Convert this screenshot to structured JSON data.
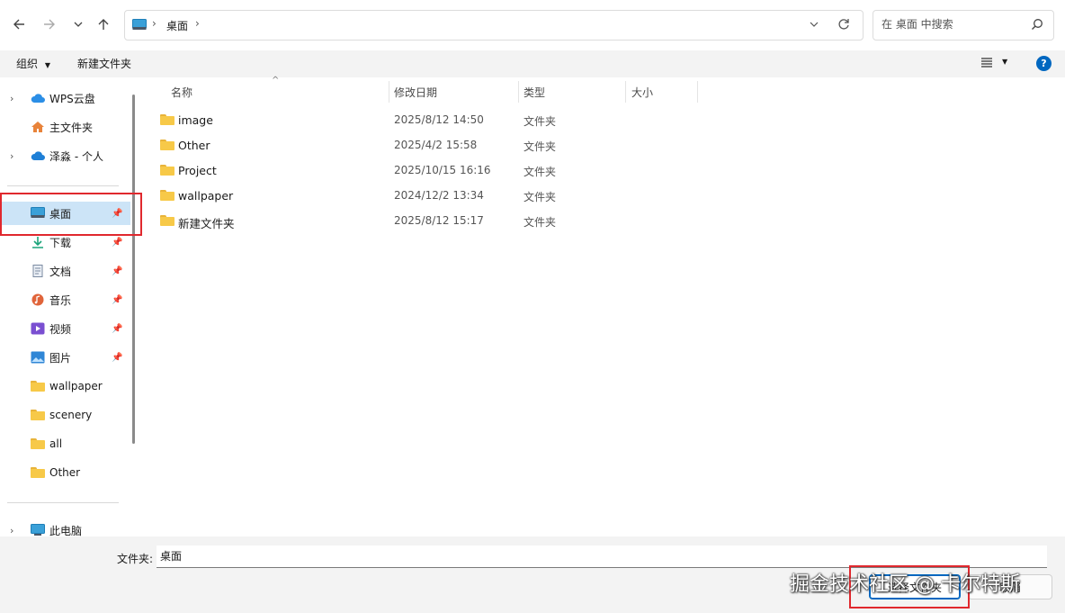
{
  "address": {
    "location": "桌面"
  },
  "search": {
    "placeholder": "在 桌面 中搜索"
  },
  "toolbar": {
    "organize_label": "组织",
    "new_folder_label": "新建文件夹"
  },
  "sidebar": {
    "top_items": [
      {
        "label": "WPS云盘"
      },
      {
        "label": "主文件夹"
      },
      {
        "label": "泽淼 - 个人"
      }
    ],
    "pinned_items": [
      {
        "label": "桌面"
      },
      {
        "label": "下载"
      },
      {
        "label": "文档"
      },
      {
        "label": "音乐"
      },
      {
        "label": "视频"
      },
      {
        "label": "图片"
      }
    ],
    "folder_items": [
      {
        "label": "wallpaper"
      },
      {
        "label": "scenery"
      },
      {
        "label": "all"
      },
      {
        "label": "Other"
      }
    ],
    "this_pc_label": "此电脑"
  },
  "columns": {
    "name": "名称",
    "date": "修改日期",
    "type": "类型",
    "size": "大小"
  },
  "files": [
    {
      "name": "image",
      "date": "2025/8/12 14:50",
      "type": "文件夹"
    },
    {
      "name": "Other",
      "date": "2025/4/2 15:58",
      "type": "文件夹"
    },
    {
      "name": "Project",
      "date": "2025/10/15 16:16",
      "type": "文件夹"
    },
    {
      "name": "wallpaper",
      "date": "2024/12/2 13:34",
      "type": "文件夹"
    },
    {
      "name": "新建文件夹",
      "date": "2025/8/12 15:17",
      "type": "文件夹"
    }
  ],
  "footer": {
    "folder_label": "文件夹:",
    "folder_value": "桌面",
    "select_button": "选择文件夹",
    "cancel_button": "取消"
  },
  "watermark": "掘金技术社区 @ 卡尔特斯",
  "colors": {
    "accent": "#0067c0",
    "highlight": "#e0282e",
    "folder": "#f7c948",
    "selected_bg": "#cce4f7"
  }
}
